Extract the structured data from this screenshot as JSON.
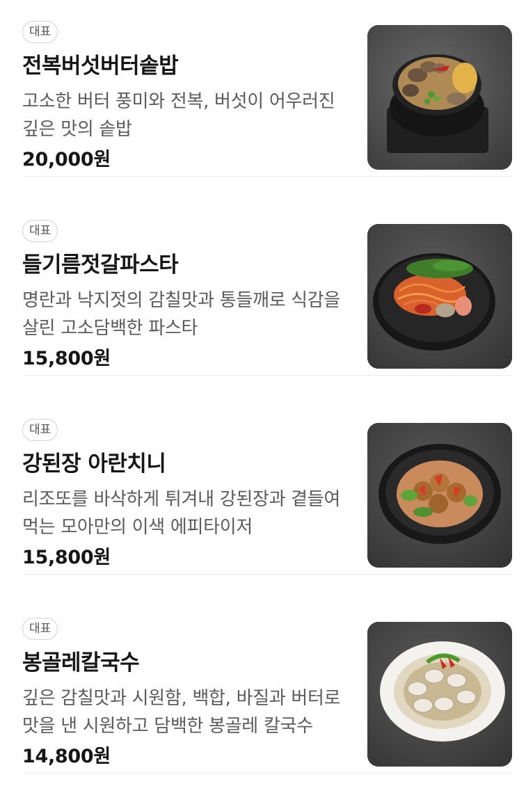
{
  "menu": {
    "items": [
      {
        "badge": "대표",
        "name": "전복버섯버터솥밥",
        "description": "고소한 버터 풍미와 전복, 버섯이 어우러진 깊은 맛의 솥밥",
        "price": "20,000원",
        "image_icon": "abalone-rice-pot-photo"
      },
      {
        "badge": "대표",
        "name": "들기름젓갈파스타",
        "description": "명란과 낙지젓의 감칠맛과 통들깨로 식감을 살린 고소담백한 파스타",
        "price": "15,800원",
        "image_icon": "pasta-bowl-photo"
      },
      {
        "badge": "대표",
        "name": "강된장 아란치니",
        "description": "리조또를 바삭하게 튀겨내 강된장과 곁들여 먹는 모아만의 이색 에피타이저",
        "price": "15,800원",
        "image_icon": "arancini-bowl-photo"
      },
      {
        "badge": "대표",
        "name": "봉골레칼국수",
        "description": "깊은 감칠맛과 시원함, 백합, 바질과 버터로 맛을 낸 시원하고 담백한 봉골레 칼국수",
        "price": "14,800원",
        "image_icon": "clam-noodle-bowl-photo"
      }
    ]
  }
}
